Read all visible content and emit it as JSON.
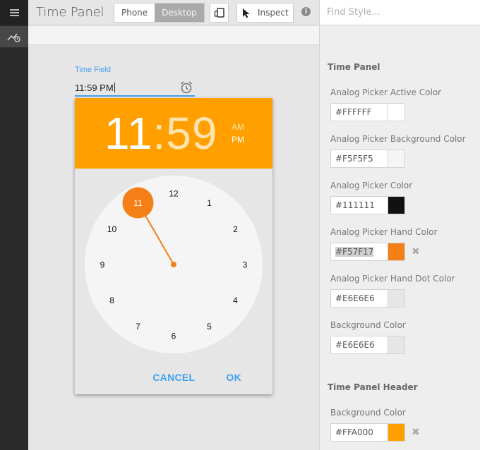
{
  "app": {
    "title": "Time Panel",
    "view_modes": [
      {
        "label": "Phone",
        "active": false
      },
      {
        "label": "Desktop",
        "active": true
      }
    ],
    "inspect_label": "Inspect",
    "info_glyph": "i",
    "search_placeholder": "Find Style..."
  },
  "icons": {
    "menu": "hamburger-icon",
    "rail_item": "chart-clock-icon",
    "device": "device-rotate-icon",
    "inspect": "cursor-arrow-icon",
    "info": "info-icon",
    "alarm": "alarm-clock-icon",
    "clear": "close-x-icon"
  },
  "time_field": {
    "label": "Time Field",
    "value": "11:59 PM"
  },
  "picker": {
    "hour": "11",
    "separator": ":",
    "minute": "59",
    "am_label": "AM",
    "pm_label": "PM",
    "selected_period": "PM",
    "clock_numbers": [
      "12",
      "1",
      "2",
      "3",
      "4",
      "5",
      "6",
      "7",
      "8",
      "9",
      "10",
      "11"
    ],
    "selected_hour": 11,
    "cancel_label": "CANCEL",
    "ok_label": "OK",
    "colors": {
      "header": "#FFA000",
      "hand": "#F57F17",
      "face": "#F5F5F5",
      "numbers": "#111111",
      "active_number": "#FFFFFF",
      "background": "#E6E6E6"
    }
  },
  "styles_panel": {
    "sections": [
      {
        "title": "Time Panel",
        "properties": [
          {
            "label": "Analog Picker Active Color",
            "value": "#FFFFFF",
            "swatch": "#FFFFFF",
            "clearable": false,
            "selected": false
          },
          {
            "label": "Analog Picker Background Color",
            "value": "#F5F5F5",
            "swatch": "#F5F5F5",
            "clearable": false,
            "selected": false
          },
          {
            "label": "Analog Picker Color",
            "value": "#111111",
            "swatch": "#111111",
            "clearable": false,
            "selected": false
          },
          {
            "label": "Analog Picker Hand Color",
            "value": "#F57F17",
            "swatch": "#F57F17",
            "clearable": true,
            "selected": true
          },
          {
            "label": "Analog Picker Hand Dot Color",
            "value": "#E6E6E6",
            "swatch": "#E6E6E6",
            "clearable": false,
            "selected": false
          },
          {
            "label": "Background Color",
            "value": "#E6E6E6",
            "swatch": "#E6E6E6",
            "clearable": false,
            "selected": false
          }
        ]
      },
      {
        "title": "Time Panel Header",
        "properties": [
          {
            "label": "Background Color",
            "value": "#FFA000",
            "swatch": "#FFA000",
            "clearable": true,
            "selected": false
          }
        ]
      }
    ],
    "clear_glyph": "✖"
  }
}
